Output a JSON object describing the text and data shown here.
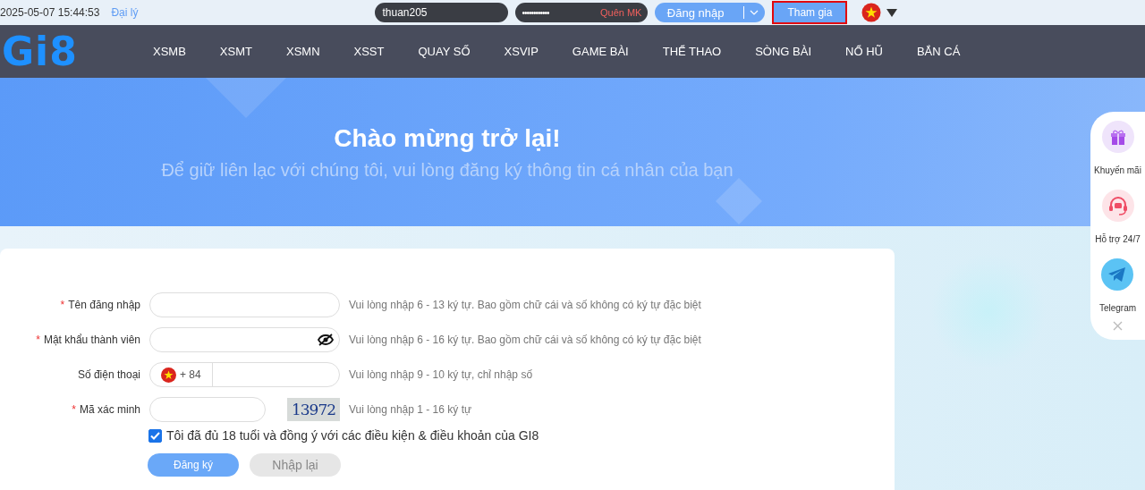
{
  "top_bar": {
    "datetime": "2025-05-07 15:44:53",
    "agent_link": "Đại lý",
    "username": "thuan205",
    "password_mask": "••••••••••••",
    "forgot_link": "Quên MK",
    "login_button": "Đăng nhập",
    "join_button": {
      "label": "Tham gia",
      "highlighted": true
    }
  },
  "nav": {
    "logo": "Gi8",
    "items": [
      {
        "label": "XSMB"
      },
      {
        "label": "XSMT"
      },
      {
        "label": "XSMN"
      },
      {
        "label": "XSST"
      },
      {
        "label": "QUAY SỐ"
      },
      {
        "label": "XSVIP"
      },
      {
        "label": "GAME BÀI"
      },
      {
        "label": "THỂ THAO"
      },
      {
        "label": "SÒNG BÀI"
      },
      {
        "label": "NỔ HŨ"
      },
      {
        "label": "BẮN CÁ"
      }
    ]
  },
  "hero": {
    "title": "Chào mừng trở lại!",
    "subtitle": "Để giữ liên lạc với chúng tôi, vui lòng đăng ký thông tin cá nhân của bạn"
  },
  "form": {
    "fields": [
      {
        "kind": "text",
        "label": "Tên đăng nhập",
        "required_mark": "*",
        "hint": "Vui lòng nhập 6 - 13 ký tự. Bao gồm chữ cái và số không có ký tự đặc biệt"
      },
      {
        "kind": "password",
        "label": "Mật khẩu thành viên",
        "required_mark": "*",
        "hint": "Vui lòng nhập 6 - 16 ký tự. Bao gồm chữ cái và số không có ký tự đặc biệt"
      },
      {
        "kind": "phone",
        "label": "Số điện thoại",
        "country_code": "+ 84",
        "hint": "Vui lòng nhập 9 - 10 ký tự, chỉ nhập số"
      },
      {
        "kind": "captcha",
        "label": "Mã xác minh",
        "required_mark": "*",
        "captcha": "13972",
        "hint": "Vui lòng nhập 1 - 16 ký tự"
      }
    ],
    "agree": {
      "checked": true,
      "text": "Tôi đã đủ 18 tuổi và đồng ý với các điều kiện & điều khoản của GI8"
    },
    "submit_button": "Đăng ký",
    "reset_button": "Nhập lại"
  },
  "side_panel": {
    "items": [
      {
        "kind": "gift",
        "label": "Khuyến mãi"
      },
      {
        "kind": "support",
        "label": "Hỗ trợ 24/7"
      },
      {
        "kind": "telegram",
        "label": "Telegram"
      }
    ]
  }
}
